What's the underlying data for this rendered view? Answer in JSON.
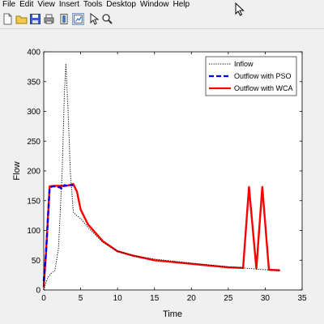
{
  "menu": [
    "File",
    "Edit",
    "View",
    "Insert",
    "Tools",
    "Desktop",
    "Window",
    "Help"
  ],
  "toolbar_icons": [
    "new-file-icon",
    "open-folder-icon",
    "save-icon",
    "print-icon",
    "link-plot-icon",
    "insert-colorbar-icon",
    "edit-plot-arrow-icon",
    "zoom-icon"
  ],
  "chart_data": {
    "type": "line",
    "title": "",
    "xlabel": "Time",
    "ylabel": "Flow",
    "xlim": [
      0,
      35
    ],
    "ylim": [
      0,
      400
    ],
    "xticks": [
      0,
      5,
      10,
      15,
      20,
      25,
      30,
      35
    ],
    "yticks": [
      0,
      50,
      100,
      150,
      200,
      250,
      300,
      350,
      400
    ],
    "grid": false,
    "legend_position": "top-right",
    "series": [
      {
        "name": "Inflow",
        "style": "dotted",
        "color": "#000000",
        "x": [
          0,
          0.5,
          1,
          1.5,
          2,
          2.5,
          2.8,
          3.0,
          3.3,
          3.6,
          4.0,
          4.5,
          5,
          6,
          8,
          10,
          12,
          15,
          20,
          25,
          27,
          28,
          29,
          30,
          31,
          32
        ],
        "y": [
          0,
          20,
          28,
          32,
          70,
          200,
          330,
          380,
          300,
          200,
          130,
          125,
          120,
          105,
          80,
          65,
          58,
          52,
          45,
          39,
          37,
          36,
          35,
          34,
          33,
          32
        ]
      },
      {
        "name": "Outflow with PSO",
        "style": "dashed",
        "color": "#0000ff",
        "x": [
          0,
          0.3,
          0.8,
          1.2,
          1.8,
          2.2,
          2.5,
          2.8,
          3.2,
          3.6,
          4.0
        ],
        "y": [
          15,
          60,
          172,
          174,
          174,
          172,
          170,
          176,
          175,
          176,
          176
        ]
      },
      {
        "name": "Outflow with WCA",
        "style": "solid",
        "color": "#ff0000",
        "x": [
          0,
          0.3,
          0.8,
          1.5,
          2.5,
          3.0,
          3.5,
          4.0,
          4.5,
          5,
          6,
          8,
          10,
          12,
          15,
          20,
          25,
          27,
          27.8,
          28.8,
          29.6,
          30.5,
          32
        ],
        "y": [
          5,
          60,
          174,
          175,
          175,
          175,
          176,
          178,
          165,
          135,
          110,
          82,
          65,
          58,
          50,
          44,
          38,
          37,
          173,
          36,
          173,
          34,
          33
        ]
      }
    ]
  }
}
